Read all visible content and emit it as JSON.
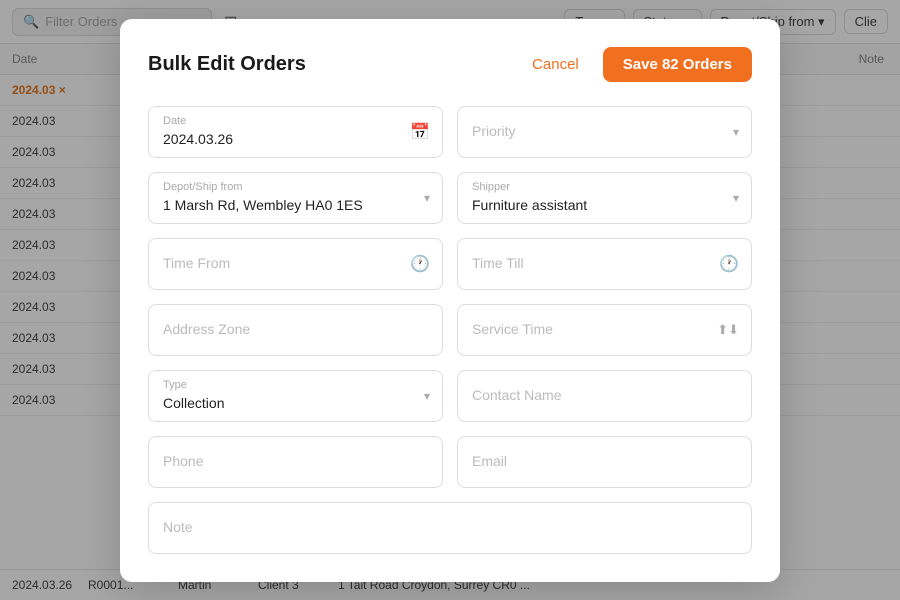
{
  "background": {
    "search_placeholder": "Filter Orders",
    "filter_icon": "▼",
    "chips": [
      "Type ▾",
      "Status ▾",
      "Depot/Ship from ▾",
      "Clie"
    ],
    "table_headers": [
      "Date",
      "Note"
    ],
    "rows": [
      "2024.03",
      "2024.03",
      "2024.03",
      "2024.03",
      "2024.03",
      "2024.03",
      "2024.03",
      "2024.03",
      "2024.03",
      "2024.03",
      "2024.03"
    ],
    "bottom_row": {
      "date": "2024.03.26",
      "ref": "R0001...",
      "name": "Martin",
      "client": "Client 3",
      "address": "1 Tait Road Croydon, Surrey CR0 ..."
    }
  },
  "modal": {
    "title": "Bulk Edit Orders",
    "cancel_label": "Cancel",
    "save_label": "Save 82 Orders",
    "fields": {
      "date_label": "Date",
      "date_value": "2024.03.26",
      "priority_placeholder": "Priority",
      "depot_label": "Depot/Ship from",
      "depot_value": "1 Marsh Rd, Wembley HA0 1ES",
      "shipper_label": "Shipper",
      "shipper_value": "Furniture assistant",
      "time_from_placeholder": "Time From",
      "time_till_placeholder": "Time Till",
      "address_zone_placeholder": "Address Zone",
      "service_time_placeholder": "Service Time",
      "type_label": "Type",
      "type_value": "Collection",
      "contact_name_placeholder": "Contact Name",
      "phone_placeholder": "Phone",
      "email_placeholder": "Email",
      "note_placeholder": "Note"
    }
  }
}
